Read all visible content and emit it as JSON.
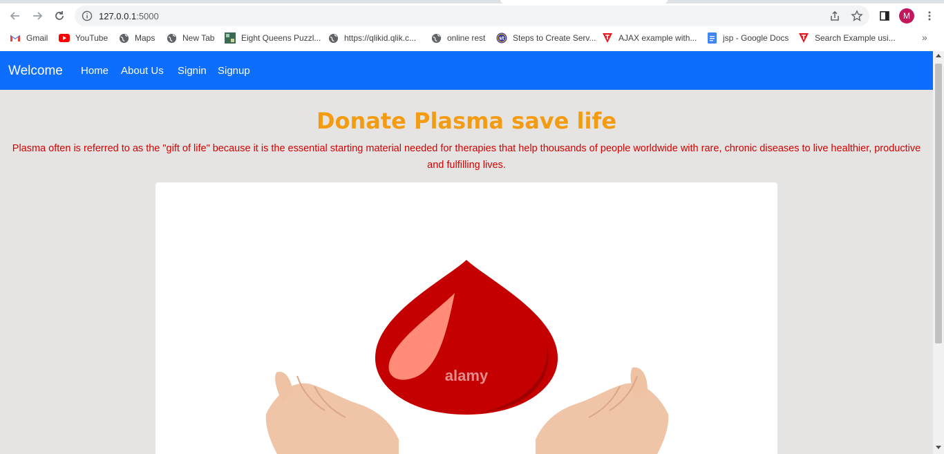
{
  "browser": {
    "url_host": "127.0.0.1",
    "url_port": ":5000",
    "profile_initial": "M",
    "bookmarks": [
      {
        "label": "Gmail",
        "icon": "gmail-icon"
      },
      {
        "label": "YouTube",
        "icon": "youtube-icon"
      },
      {
        "label": "Maps",
        "icon": "globe-icon"
      },
      {
        "label": "New Tab",
        "icon": "globe-icon"
      },
      {
        "label": "Eight Queens Puzzl...",
        "icon": "image-icon"
      },
      {
        "label": "https://qlikid.qlik.c...",
        "icon": "globe-icon"
      },
      {
        "label": "online rest",
        "icon": "globe-icon"
      },
      {
        "label": "Steps to Create Serv...",
        "icon": "st-icon"
      },
      {
        "label": "AJAX example with...",
        "icon": "t-logo-icon"
      },
      {
        "label": "jsp - Google Docs",
        "icon": "docs-icon"
      },
      {
        "label": "Search Example usi...",
        "icon": "t-logo-icon"
      }
    ],
    "bookmarks_more": "»"
  },
  "navbar": {
    "brand": "Welcome",
    "links": [
      "Home",
      "About Us",
      "Signin",
      "Signup"
    ]
  },
  "hero": {
    "title": "Donate Plasma save life",
    "lead": "Plasma often is referred to as the \"gift of life\" because it is the essential starting material needed for therapies that help thousands of people worldwide with rare, chronic diseases to live healthier, productive and fulfilling lives.",
    "image_watermark": "alamy"
  },
  "colors": {
    "navbar": "#0d6efd",
    "title": "#f39c12",
    "lead": "#d60000",
    "drop": "#c40000",
    "hands": "#f0c4a6"
  }
}
